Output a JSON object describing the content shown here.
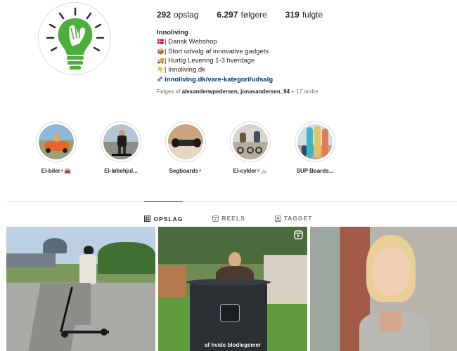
{
  "profile": {
    "stats": [
      {
        "value": "292",
        "label": "opslag"
      },
      {
        "value": "6.297",
        "label": "følgere"
      },
      {
        "value": "319",
        "label": "fulgte"
      }
    ],
    "name": "Innoliving",
    "bio_lines": [
      {
        "emoji": "🇩🇰",
        "text": "| Dansk Webshop"
      },
      {
        "emoji": "📦",
        "text": "| Stort udvalg af innovative gadgets"
      },
      {
        "emoji": "🚚",
        "text": "| Hurtig Levering 1-3 hverdage"
      },
      {
        "emoji": "👇",
        "text": "| Innoliving.dk"
      }
    ],
    "link": "innoliving.dk/vare-kategori/udsalg",
    "followed_prefix": "Følges af ",
    "followed_users": "alexanderwpedersen, jonasandersen_94",
    "followed_suffix": " + 17 andre"
  },
  "highlights": [
    {
      "label": "El-biler⚡🚘"
    },
    {
      "label": "El-løbehjul..."
    },
    {
      "label": "Segboards⚡"
    },
    {
      "label": "El-cykler⚡🚲"
    },
    {
      "label": "SUP Boards..."
    }
  ],
  "tabs": [
    {
      "label": "OPSLAG",
      "icon": "grid-icon",
      "active": true
    },
    {
      "label": "REELS",
      "icon": "reels-icon",
      "active": false
    },
    {
      "label": "TAGGET",
      "icon": "tagged-icon",
      "active": false
    }
  ],
  "posts": [
    {
      "caption": ""
    },
    {
      "caption": "af hvide blodlegemer"
    },
    {
      "caption": ""
    }
  ],
  "colors": {
    "brand_green": "#4caf3a",
    "link_blue": "#00376b",
    "muted_gray": "#737373",
    "border_gray": "#dbdbdb"
  }
}
